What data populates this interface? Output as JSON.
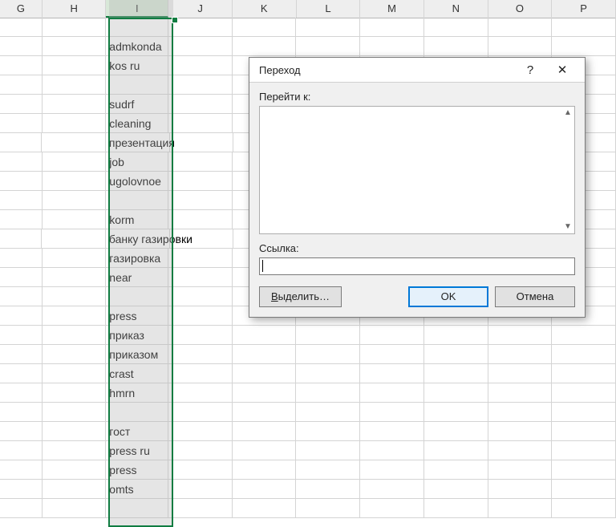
{
  "columns": [
    "G",
    "H",
    "I",
    "J",
    "K",
    "L",
    "M",
    "N",
    "O",
    "P"
  ],
  "selected_column": "I",
  "column_i_values": {
    "2": "admkonda",
    "3": "kos ru",
    "4": "",
    "5": "sudrf",
    "6": "cleaning",
    "7": "презентация",
    "8": "job",
    "9": "ugolovnoe",
    "10": "",
    "11": "korm",
    "12": "банку газировки",
    "13": "газировка",
    "14": "near",
    "15": "",
    "16": "press",
    "17": "приказ",
    "18": "приказом",
    "19": "crast",
    "20": "hmrn",
    "21": "",
    "22": "гост",
    "23": "press ru",
    "24": "press",
    "25": "omts"
  },
  "dialog": {
    "title": "Переход",
    "help_label": "?",
    "close_label": "✕",
    "goto_label": "Перейти к:",
    "ref_label": "Ссылка:",
    "ref_value": "",
    "select_u": "В",
    "select_rest": "ыделить…",
    "ok": "OK",
    "cancel": "Отмена"
  }
}
